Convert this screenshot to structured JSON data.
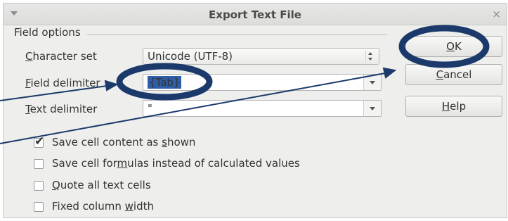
{
  "window": {
    "title": "Export Text File",
    "menu_icon": "chevron-down-icon",
    "close_glyph": "×"
  },
  "field_options": {
    "legend": "Field options",
    "character_set": {
      "label_pre": "",
      "label_u": "C",
      "label_post": "haracter set",
      "value": "Unicode (UTF-8)"
    },
    "field_delimiter": {
      "label_u": "F",
      "label_post": "ield delimiter",
      "value": "{Tab}"
    },
    "text_delimiter": {
      "label_u": "T",
      "label_post": "ext delimiter",
      "value": "\""
    }
  },
  "options": [
    {
      "pre": "Save cell content as ",
      "u": "s",
      "post": "hown",
      "checked": true
    },
    {
      "pre": "Save cell for",
      "u": "m",
      "post": "ulas instead of calculated values",
      "checked": false
    },
    {
      "pre": "",
      "u": "Q",
      "post": "uote all text cells",
      "checked": false
    },
    {
      "pre": "Fixed column ",
      "u": "w",
      "post": "idth",
      "checked": false
    }
  ],
  "buttons": {
    "ok": {
      "u": "O",
      "post": "K"
    },
    "cancel": {
      "u": "C",
      "post": "ancel"
    },
    "help": {
      "u": "H",
      "post": "elp"
    }
  },
  "annotation_color": "#1b3a6b"
}
